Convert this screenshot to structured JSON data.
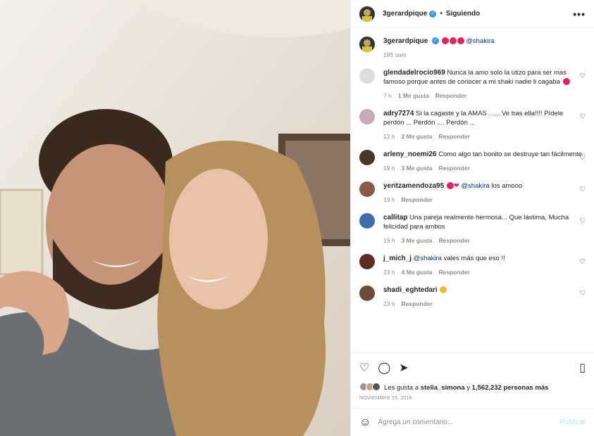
{
  "header": {
    "username": "3gerardpique",
    "dot": "•",
    "follow_status": "Siguiendo",
    "more": "•••"
  },
  "caption": {
    "username": "3gerardpique",
    "mention": "@shakira",
    "time": "185 sem"
  },
  "comments": [
    {
      "user": "glendadelrocio969",
      "text": "Nunca la amo solo la utizo para ser mas famoso porque antes de conocer a mi shaki nadie li cagaba",
      "time": "7 h",
      "likes": "1 Me gusta",
      "reply": "Responder"
    },
    {
      "user": "adry7274",
      "text": "Si la cagaste y la AMAS . .... Ve tras ella!!!! Pídele perdón ... Perdón .... Perdón ...",
      "time": "12 h",
      "likes": "2 Me gusta",
      "reply": "Responder"
    },
    {
      "user": "arleny_noemi26",
      "text": "Como algo tan bonito se destruye tan fácilmente",
      "time": "19 h",
      "likes": "3 Me gusta",
      "reply": "Responder"
    },
    {
      "user": "yeritzamendoza95",
      "mention": "@shakira",
      "text": "los amooo",
      "time": "19 h",
      "likes": "",
      "reply": "Responder"
    },
    {
      "user": "callitap",
      "text": "Una pareja realmente hermosa... Que lástima, Mucha felicidad para ambos",
      "time": "19 h",
      "likes": "3 Me gusta",
      "reply": "Responder"
    },
    {
      "user": "j_mich_j",
      "mention": "@shakira",
      "text": "vales más que eso !!",
      "time": "23 h",
      "likes": "4 Me gusta",
      "reply": "Responder"
    },
    {
      "user": "shadi_eghtedari",
      "text": "",
      "time": "23 h",
      "likes": "",
      "reply": "Responder"
    }
  ],
  "likes": {
    "prefix": "Les gusta a",
    "user": "stella_simona",
    "mid": "y",
    "count": "1,562,232 personas más"
  },
  "date": "NOVIEMBRE 15, 2018",
  "add_comment": {
    "placeholder": "Agrega un comentario...",
    "publish": "Publicar"
  },
  "icons": {
    "like": "heart-icon",
    "comment": "comment-icon",
    "share": "send-icon",
    "save": "bookmark-icon"
  },
  "colors": {
    "link": "#00376b",
    "verified": "#3897f0",
    "muted": "#8e8e8e"
  }
}
